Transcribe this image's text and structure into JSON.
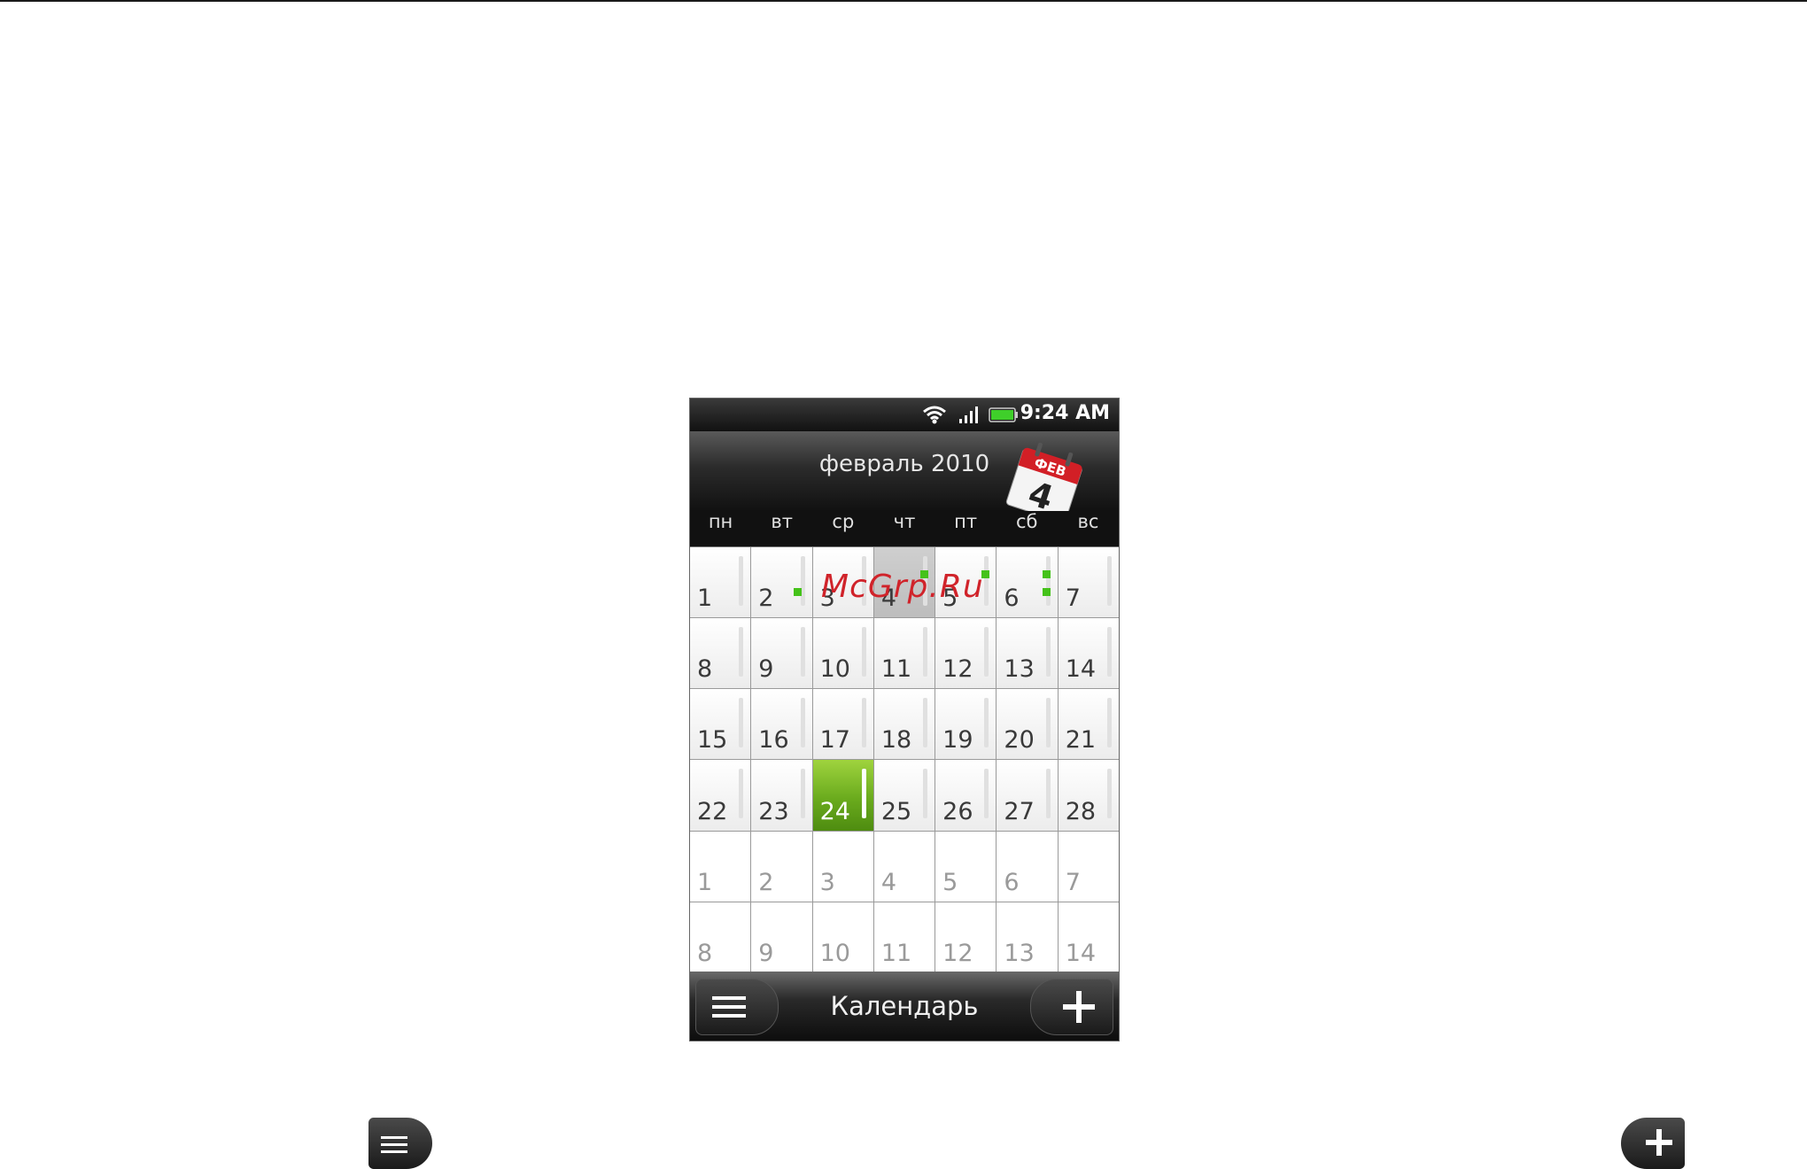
{
  "status_bar": {
    "time": "9:24 AM",
    "icons": [
      "wifi-icon",
      "signal-icon",
      "battery-icon"
    ]
  },
  "header": {
    "month_title": "февраль 2010",
    "badge_month": "ФЕВ",
    "badge_day": "4"
  },
  "weekdays": [
    "пн",
    "вт",
    "ср",
    "чт",
    "пт",
    "сб",
    "вс"
  ],
  "calendar": {
    "weeks": [
      [
        "1",
        "2",
        "3",
        "4",
        "5",
        "6",
        "7"
      ],
      [
        "8",
        "9",
        "10",
        "11",
        "12",
        "13",
        "14"
      ],
      [
        "15",
        "16",
        "17",
        "18",
        "19",
        "20",
        "21"
      ],
      [
        "22",
        "23",
        "24",
        "25",
        "26",
        "27",
        "28"
      ],
      [
        "1",
        "2",
        "3",
        "4",
        "5",
        "6",
        "7"
      ],
      [
        "8",
        "9",
        "10",
        "11",
        "12",
        "13",
        "14"
      ]
    ],
    "today": "24",
    "selected": "4"
  },
  "watermark": "McGrp.Ru",
  "bottom_bar": {
    "title": "Календарь",
    "menu_icon": "menu-icon",
    "add_icon": "plus-icon"
  },
  "colors": {
    "accent_green": "#6aab1d",
    "event_green": "#45c21a",
    "watermark_red": "#d0232a"
  }
}
